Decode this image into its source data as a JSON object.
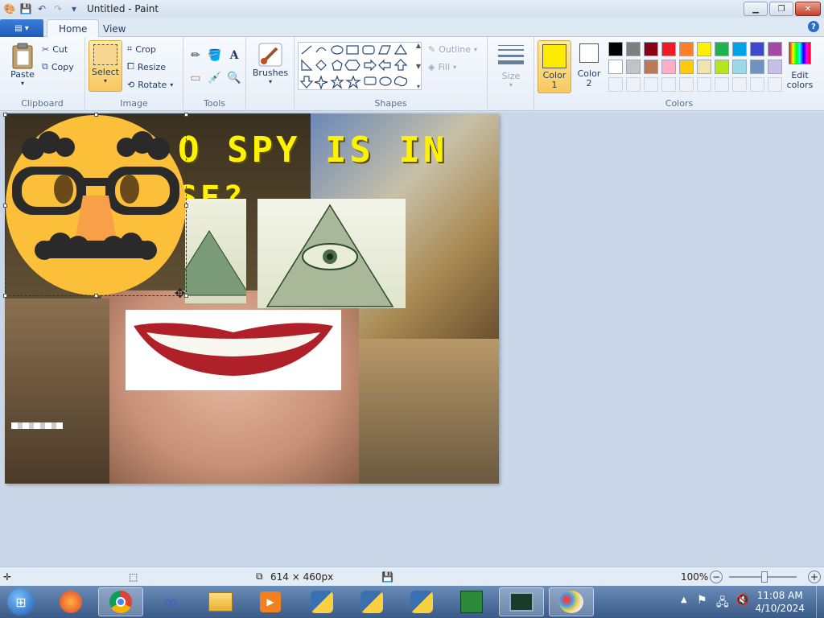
{
  "window": {
    "title": "Untitled - Paint",
    "minimize_label": "▁",
    "maximize_label": "❐",
    "close_label": "✕"
  },
  "tabs": {
    "file_label": "▤ ▾",
    "home_label": "Home",
    "view_label": "View",
    "help_label": "?"
  },
  "clipboard": {
    "paste_label": "Paste",
    "cut_label": "Cut",
    "copy_label": "Copy",
    "group_label": "Clipboard"
  },
  "image": {
    "select_label": "Select",
    "crop_label": "Crop",
    "resize_label": "Resize",
    "rotate_label": "Rotate",
    "group_label": "Image"
  },
  "tools": {
    "group_label": "Tools"
  },
  "brushes": {
    "label": "Brushes"
  },
  "shapes": {
    "outline_label": "Outline",
    "fill_label": "Fill",
    "group_label": "Shapes"
  },
  "size": {
    "label": "Size"
  },
  "colors": {
    "color1_label": "Color\n1",
    "color1_line1": "Color",
    "color1_line2": "1",
    "color2_line1": "Color",
    "color2_line2": "2",
    "edit_line1": "Edit",
    "edit_line2": "colors",
    "group_label": "Colors",
    "color1_value": "#ffeb00",
    "color2_value": "#ffffff",
    "palette_row1": [
      "#000000",
      "#7f7f7f",
      "#880015",
      "#ed1c24",
      "#ff7f27",
      "#fff200",
      "#22b14c",
      "#00a2e8",
      "#3f48cc",
      "#a349a4"
    ],
    "palette_row2": [
      "#ffffff",
      "#c3c3c3",
      "#b97a57",
      "#ffaec9",
      "#ffc90e",
      "#efe4b0",
      "#b5e61d",
      "#99d9ea",
      "#7092be",
      "#c8bfe7"
    ]
  },
  "canvas": {
    "meme_text_line1": "O SPY IS IN",
    "meme_text_line2": "SE?"
  },
  "statusbar": {
    "dimensions": "614 × 460px",
    "zoom": "100%"
  },
  "taskbar": {
    "time": "11:08 AM",
    "date": "4/10/2024"
  }
}
